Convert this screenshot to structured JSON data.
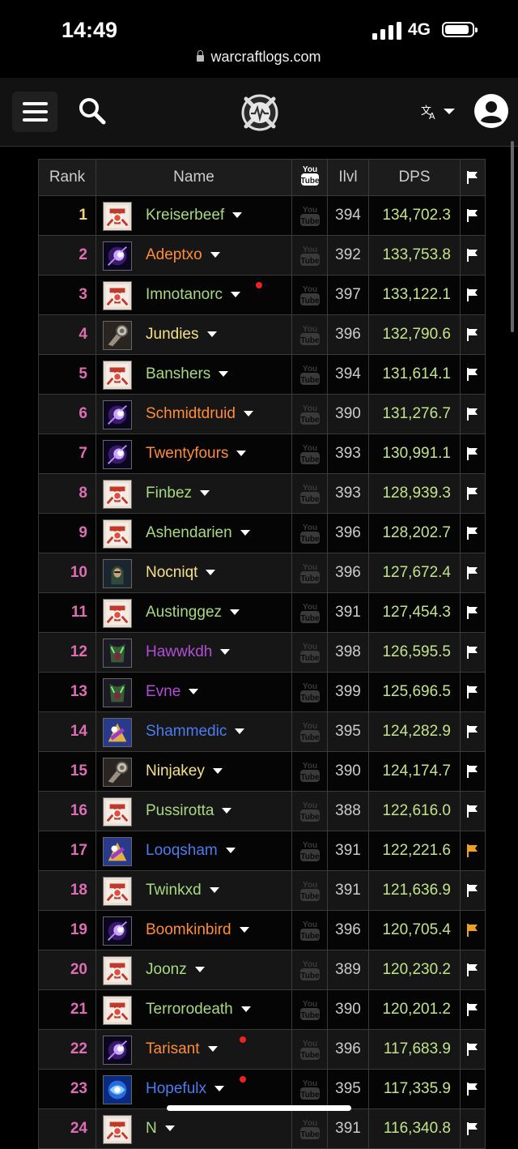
{
  "status_bar": {
    "time": "14:49",
    "network": "4G"
  },
  "url": "warcraftlogs.com",
  "table": {
    "headers": {
      "rank": "Rank",
      "name": "Name",
      "ilvl": "Ilvl",
      "dps": "DPS"
    },
    "rows": [
      {
        "rank": "1",
        "name": "Kreiserbeef",
        "ilvl": "394",
        "dps": "134,702.3",
        "spec": "paladin",
        "color": "#a8d982",
        "dot": false,
        "flag": "white"
      },
      {
        "rank": "2",
        "name": "Adeptxo",
        "ilvl": "392",
        "dps": "133,753.8",
        "spec": "balance",
        "color": "#ff8c3a",
        "dot": false,
        "flag": "white"
      },
      {
        "rank": "3",
        "name": "Imnotanorc",
        "ilvl": "397",
        "dps": "133,122.1",
        "spec": "paladin",
        "color": "#a8d982",
        "dot": true,
        "flag": "white"
      },
      {
        "rank": "4",
        "name": "Jundies",
        "ilvl": "396",
        "dps": "132,790.6",
        "spec": "warrior",
        "color": "#f5e08a",
        "dot": false,
        "flag": "white"
      },
      {
        "rank": "5",
        "name": "Banshers",
        "ilvl": "394",
        "dps": "131,614.1",
        "spec": "paladin",
        "color": "#a8d982",
        "dot": false,
        "flag": "white"
      },
      {
        "rank": "6",
        "name": "Schmidtdruid",
        "ilvl": "390",
        "dps": "131,276.7",
        "spec": "balance",
        "color": "#ff8c3a",
        "dot": false,
        "flag": "white"
      },
      {
        "rank": "7",
        "name": "Twentyfours",
        "ilvl": "393",
        "dps": "130,991.1",
        "spec": "balance",
        "color": "#ff8c3a",
        "dot": false,
        "flag": "white"
      },
      {
        "rank": "8",
        "name": "Finbez",
        "ilvl": "393",
        "dps": "128,939.3",
        "spec": "paladin",
        "color": "#a8d982",
        "dot": false,
        "flag": "white"
      },
      {
        "rank": "9",
        "name": "Ashendarien",
        "ilvl": "396",
        "dps": "128,202.7",
        "spec": "paladin",
        "color": "#a8d982",
        "dot": false,
        "flag": "white"
      },
      {
        "rank": "10",
        "name": "Nocniqt",
        "ilvl": "396",
        "dps": "127,672.4",
        "spec": "rogue",
        "color": "#f5e08a",
        "dot": false,
        "flag": "white"
      },
      {
        "rank": "11",
        "name": "Austinggez",
        "ilvl": "391",
        "dps": "127,454.3",
        "spec": "paladin",
        "color": "#a8d982",
        "dot": false,
        "flag": "white"
      },
      {
        "rank": "12",
        "name": "Hawwkdh",
        "ilvl": "398",
        "dps": "126,595.5",
        "spec": "demonhunter",
        "color": "#b04fd6",
        "dot": false,
        "flag": "white"
      },
      {
        "rank": "13",
        "name": "Evne",
        "ilvl": "399",
        "dps": "125,696.5",
        "spec": "demonhunter",
        "color": "#b04fd6",
        "dot": false,
        "flag": "white"
      },
      {
        "rank": "14",
        "name": "Shammedic",
        "ilvl": "395",
        "dps": "124,282.9",
        "spec": "shaman",
        "color": "#4b7cf0",
        "dot": false,
        "flag": "white"
      },
      {
        "rank": "15",
        "name": "Ninjakey",
        "ilvl": "390",
        "dps": "124,174.7",
        "spec": "warrior",
        "color": "#f5e08a",
        "dot": false,
        "flag": "white"
      },
      {
        "rank": "16",
        "name": "Pussirotta",
        "ilvl": "388",
        "dps": "122,616.0",
        "spec": "paladin",
        "color": "#a8d982",
        "dot": false,
        "flag": "white"
      },
      {
        "rank": "17",
        "name": "Looqsham",
        "ilvl": "391",
        "dps": "122,221.6",
        "spec": "shaman",
        "color": "#4b7cf0",
        "dot": false,
        "flag": "orange"
      },
      {
        "rank": "18",
        "name": "Twinkxd",
        "ilvl": "391",
        "dps": "121,636.9",
        "spec": "paladin",
        "color": "#a8d982",
        "dot": false,
        "flag": "white"
      },
      {
        "rank": "19",
        "name": "Boomkinbird",
        "ilvl": "396",
        "dps": "120,705.4",
        "spec": "balance",
        "color": "#ff8c3a",
        "dot": false,
        "flag": "orange"
      },
      {
        "rank": "20",
        "name": "Joonz",
        "ilvl": "389",
        "dps": "120,230.2",
        "spec": "paladin",
        "color": "#a8d982",
        "dot": false,
        "flag": "white"
      },
      {
        "rank": "21",
        "name": "Terrorodeath",
        "ilvl": "390",
        "dps": "120,201.2",
        "spec": "paladin",
        "color": "#a8d982",
        "dot": false,
        "flag": "white"
      },
      {
        "rank": "22",
        "name": "Tarisant",
        "ilvl": "396",
        "dps": "117,683.9",
        "spec": "balance",
        "color": "#ff8c3a",
        "dot": true,
        "flag": "white"
      },
      {
        "rank": "23",
        "name": "Hopefulx",
        "ilvl": "395",
        "dps": "117,335.9",
        "spec": "shamanblue",
        "color": "#4b7cf0",
        "dot": true,
        "flag": "white"
      },
      {
        "rank": "24",
        "name": "N",
        "ilvl": "391",
        "dps": "116,340.8",
        "spec": "paladin",
        "color": "#a8d982",
        "dot": false,
        "flag": "white"
      }
    ]
  },
  "colors": {
    "rank_pink": "#dd6eb4",
    "rank_gold": "#f4d27a",
    "dps_green": "#c3e38a",
    "flag_orange": "#f0a020"
  }
}
